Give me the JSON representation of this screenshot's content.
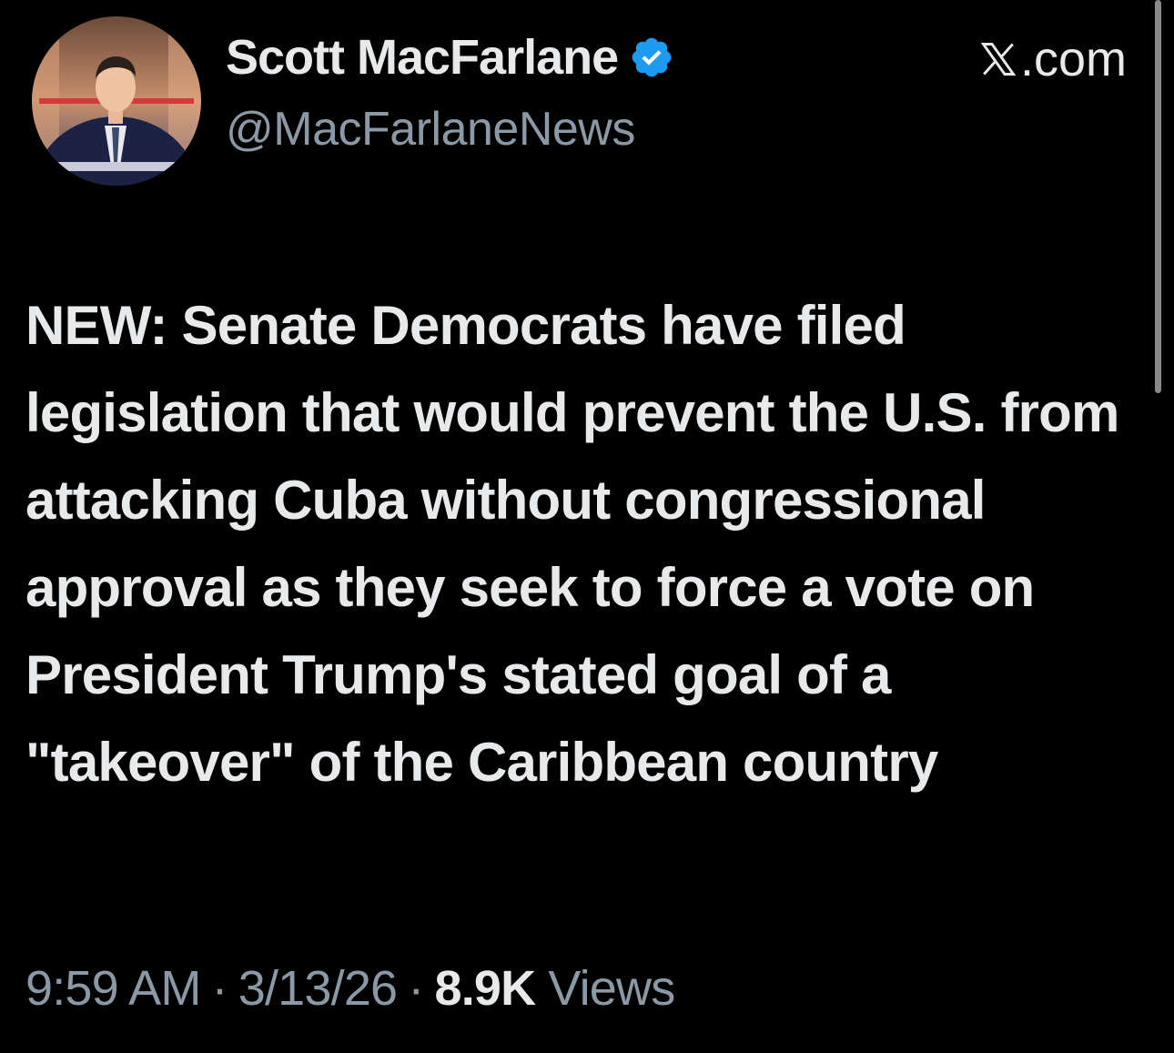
{
  "author": {
    "name": "Scott MacFarlane",
    "handle": "@MacFarlaneNews",
    "verified_icon": "verified-badge-icon",
    "avatar_icon": "avatar-photo"
  },
  "site": {
    "label": ".com",
    "icon": "x-logo-icon"
  },
  "tweet": {
    "text": "NEW:   Senate Democrats have filed legislation that would prevent the U.S. from attacking Cuba without congressional approval as they seek to force a vote on President Trump's stated goal of a \"takeover\" of the Caribbean country",
    "time": "9:59 AM",
    "separator": "·",
    "date": "3/13/26",
    "views_count": "8.9K",
    "views_label": "Views"
  },
  "colors": {
    "background": "#000000",
    "primary_text": "#e7e9ea",
    "secondary_text": "#8b98a5",
    "verified_blue": "#1d9bf0"
  }
}
